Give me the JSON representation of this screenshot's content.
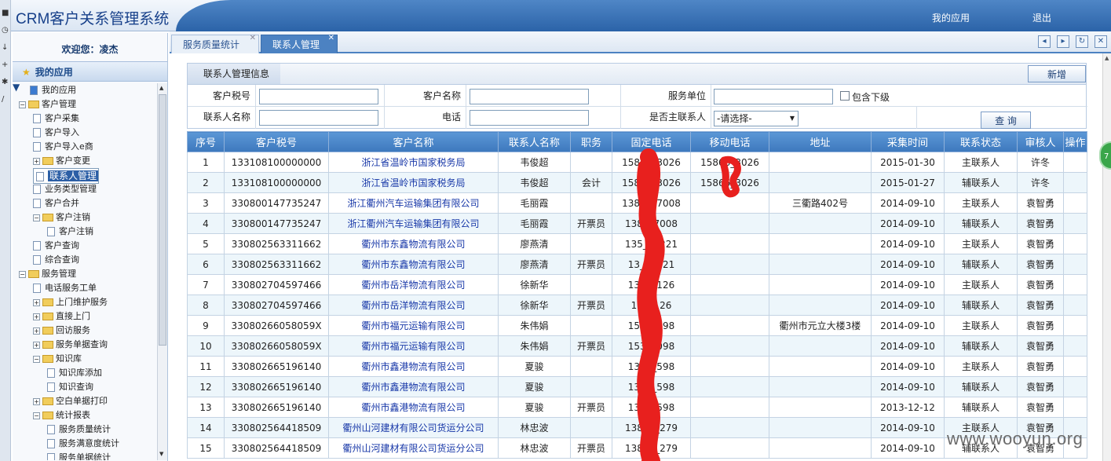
{
  "app": {
    "title": "CRM客户关系管理系统",
    "links": [
      "我的应用",
      "退出"
    ]
  },
  "sidebar": {
    "welcome": "欢迎您：凌杰",
    "section": "我的应用"
  },
  "tree": [
    {
      "label": "我的应用",
      "level": 0,
      "kind": "root"
    },
    {
      "label": "客户管理",
      "level": 0,
      "kind": "folder",
      "exp": "−"
    },
    {
      "label": "客户采集",
      "level": 1,
      "kind": "page"
    },
    {
      "label": "客户导入",
      "level": 1,
      "kind": "page"
    },
    {
      "label": "客户导入e商",
      "level": 1,
      "kind": "page"
    },
    {
      "label": "客户变更",
      "level": 1,
      "kind": "folder",
      "exp": "+"
    },
    {
      "label": "联系人管理",
      "level": 1,
      "kind": "page",
      "selected": true
    },
    {
      "label": "业务类型管理",
      "level": 1,
      "kind": "page"
    },
    {
      "label": "客户合并",
      "level": 1,
      "kind": "page"
    },
    {
      "label": "客户注销",
      "level": 1,
      "kind": "folder",
      "exp": "−"
    },
    {
      "label": "客户注销",
      "level": 2,
      "kind": "page"
    },
    {
      "label": "客户查询",
      "level": 1,
      "kind": "page"
    },
    {
      "label": "综合查询",
      "level": 1,
      "kind": "page"
    },
    {
      "label": "服务管理",
      "level": 0,
      "kind": "folder",
      "exp": "−"
    },
    {
      "label": "电话服务工单",
      "level": 1,
      "kind": "page"
    },
    {
      "label": "上门维护服务",
      "level": 1,
      "kind": "folder",
      "exp": "+"
    },
    {
      "label": "直接上门",
      "level": 1,
      "kind": "folder",
      "exp": "+"
    },
    {
      "label": "回访服务",
      "level": 1,
      "kind": "folder",
      "exp": "+"
    },
    {
      "label": "服务单据查询",
      "level": 1,
      "kind": "folder",
      "exp": "+"
    },
    {
      "label": "知识库",
      "level": 1,
      "kind": "folder",
      "exp": "−"
    },
    {
      "label": "知识库添加",
      "level": 2,
      "kind": "page"
    },
    {
      "label": "知识查询",
      "level": 2,
      "kind": "page"
    },
    {
      "label": "空白单据打印",
      "level": 1,
      "kind": "folder",
      "exp": "+"
    },
    {
      "label": "统计报表",
      "level": 1,
      "kind": "folder",
      "exp": "−"
    },
    {
      "label": "服务质量统计",
      "level": 2,
      "kind": "page"
    },
    {
      "label": "服务满意度统计",
      "level": 2,
      "kind": "page"
    },
    {
      "label": "服务单据统计",
      "level": 2,
      "kind": "page"
    }
  ],
  "tabs": [
    {
      "label": "服务质量统计",
      "active": false
    },
    {
      "label": "联系人管理",
      "active": true
    }
  ],
  "panel": {
    "title": "联系人管理信息",
    "add_button": "新增",
    "search_button": "查 询"
  },
  "form": {
    "tax_label": "客户税号",
    "name_label": "客户名称",
    "unit_label": "服务单位",
    "include_sub_label": "包含下级",
    "contact_label": "联系人名称",
    "phone_label": "电话",
    "main_contact_label": "是否主联系人",
    "main_contact_value": "-请选择-"
  },
  "table": {
    "headers": [
      "序号",
      "客户税号",
      "客户名称",
      "联系人名称",
      "职务",
      "固定电话",
      "移动电话",
      "地址",
      "采集时间",
      "联系状态",
      "审核人",
      "操作"
    ],
    "rows": [
      [
        "1",
        "133108100000000",
        "浙江省温岭市国家税务局",
        "韦俊超",
        "",
        "15866_3026",
        "15866_3026",
        "",
        "2015-01-30",
        "主联系人",
        "许冬",
        ""
      ],
      [
        "2",
        "133108100000000",
        "浙江省温岭市国家税务局",
        "韦俊超",
        "会计",
        "15866_3026",
        "15866_3026",
        "",
        "2015-01-27",
        "辅联系人",
        "许冬",
        ""
      ],
      [
        "3",
        "330800147735247",
        "浙江衢州汽车运输集团有限公司",
        "毛丽霞",
        "",
        "1381_07008",
        "",
        "三衢路402号",
        "2014-09-10",
        "主联系人",
        "袁智勇",
        ""
      ],
      [
        "4",
        "330800147735247",
        "浙江衢州汽车运输集团有限公司",
        "毛丽霞",
        "开票员",
        "138_07008",
        "",
        "",
        "2014-09-10",
        "辅联系人",
        "袁智勇",
        ""
      ],
      [
        "5",
        "330802563311662",
        "衢州市东鑫物流有限公司",
        "廖燕清",
        "",
        "135_02221",
        "",
        "",
        "2014-09-10",
        "主联系人",
        "袁智勇",
        ""
      ],
      [
        "6",
        "330802563311662",
        "衢州市东鑫物流有限公司",
        "廖燕清",
        "开票员",
        "13_02221",
        "",
        "",
        "2014-09-10",
        "辅联系人",
        "袁智勇",
        ""
      ],
      [
        "7",
        "330802704597466",
        "衢州市岳洋物流有限公司",
        "徐新华",
        "",
        "13_11126",
        "",
        "",
        "2014-09-10",
        "主联系人",
        "袁智勇",
        ""
      ],
      [
        "8",
        "330802704597466",
        "衢州市岳洋物流有限公司",
        "徐新华",
        "开票员",
        "138_126",
        "",
        "",
        "2014-09-10",
        "辅联系人",
        "袁智勇",
        ""
      ],
      [
        "9",
        "33080266058059X",
        "衢州市福元运输有限公司",
        "朱伟娟",
        "",
        "1533_098",
        "",
        "衢州市元立大楼3楼",
        "2014-09-10",
        "主联系人",
        "袁智勇",
        ""
      ],
      [
        "10",
        "33080266058059X",
        "衢州市福元运输有限公司",
        "朱伟娟",
        "开票员",
        "1533_098",
        "",
        "",
        "2014-09-10",
        "辅联系人",
        "袁智勇",
        ""
      ],
      [
        "11",
        "330802665196140",
        "衢州市鑫港物流有限公司",
        "夏骏",
        "",
        "1339_598",
        "",
        "",
        "2014-09-10",
        "主联系人",
        "袁智勇",
        ""
      ],
      [
        "12",
        "330802665196140",
        "衢州市鑫港物流有限公司",
        "夏骏",
        "",
        "1339_598",
        "",
        "",
        "2014-09-10",
        "辅联系人",
        "袁智勇",
        ""
      ],
      [
        "13",
        "330802665196140",
        "衢州市鑫港物流有限公司",
        "夏骏",
        "开票员",
        "1339_598",
        "",
        "",
        "2013-12-12",
        "辅联系人",
        "袁智勇",
        ""
      ],
      [
        "14",
        "330802564418509",
        "衢州山河建材有限公司货运分公司",
        "林忠波",
        "",
        "13857_279",
        "",
        "",
        "2014-09-10",
        "主联系人",
        "袁智勇",
        ""
      ],
      [
        "15",
        "330802564418509",
        "衢州山河建材有限公司货运分公司",
        "林忠波",
        "开票员",
        "13857_279",
        "",
        "",
        "2014-09-10",
        "辅联系人",
        "袁智勇",
        ""
      ]
    ]
  },
  "badge": "7",
  "watermark": "www.wooyun.org",
  "colors": {
    "header_blue": "#3d78bd",
    "link_blue": "#1838a8",
    "redaction_red": "#e8201e"
  }
}
